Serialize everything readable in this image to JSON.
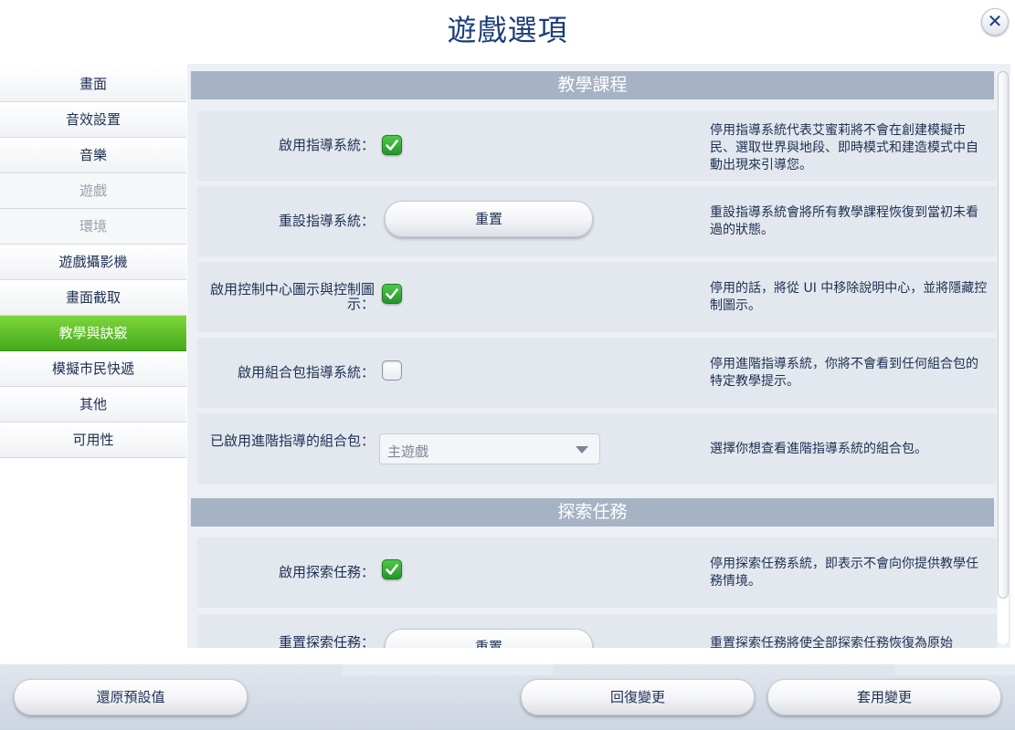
{
  "title": "遊戲選項",
  "close_icon": "close-icon",
  "sidebar": {
    "items": [
      {
        "label": "畫面",
        "state": "normal"
      },
      {
        "label": "音效設置",
        "state": "normal"
      },
      {
        "label": "音樂",
        "state": "normal"
      },
      {
        "label": "遊戲",
        "state": "disabled"
      },
      {
        "label": "環境",
        "state": "disabled"
      },
      {
        "label": "遊戲攝影機",
        "state": "normal"
      },
      {
        "label": "畫面截取",
        "state": "normal"
      },
      {
        "label": "教學與訣竅",
        "state": "active"
      },
      {
        "label": "模擬市民快遞",
        "state": "normal"
      },
      {
        "label": "其他",
        "state": "normal"
      },
      {
        "label": "可用性",
        "state": "normal"
      }
    ]
  },
  "sections": {
    "tutorial": {
      "header": "教學課程",
      "rows": [
        {
          "label": "啟用指導系統：",
          "checked": true,
          "description": "停用指導系統代表艾蜜莉將不會在創建模擬市民、選取世界與地段、即時模式和建造模式中自動出現來引導您。"
        },
        {
          "label": "重設指導系統：",
          "button": "重置",
          "description": "重設指導系統會將所有教學課程恢復到當初未看過的狀態。"
        },
        {
          "label": "啟用控制中心圖示與控制圖示：",
          "checked": true,
          "description": "停用的話，將從 UI 中移除說明中心，並將隱藏控制圖示。"
        },
        {
          "label": "啟用組合包指導系統：",
          "checked": false,
          "description": "停用進階指導系統，你將不會看到任何組合包的特定教學提示。"
        },
        {
          "label": "已啟用進階指導的組合包：",
          "select_value": "主遊戲",
          "description": "選擇你想查看進階指導系統的組合包。"
        }
      ]
    },
    "quests": {
      "header": "探索任務",
      "rows": [
        {
          "label": "啟用探索任務：",
          "checked": true,
          "description": "停用探索任務系統，即表示不會向你提供教學任務情境。"
        },
        {
          "label": "重置探索任務：",
          "button": "重置",
          "description": "重置探索任務將使全部探索任務恢復為原始"
        }
      ]
    }
  },
  "footer": {
    "restore_defaults": "還原預設值",
    "revert_changes": "回復變更",
    "apply_changes": "套用變更"
  },
  "colors": {
    "accent_green": "#4cb824",
    "section_header": "#a6b3c4",
    "title_blue": "#1b3d7a"
  }
}
